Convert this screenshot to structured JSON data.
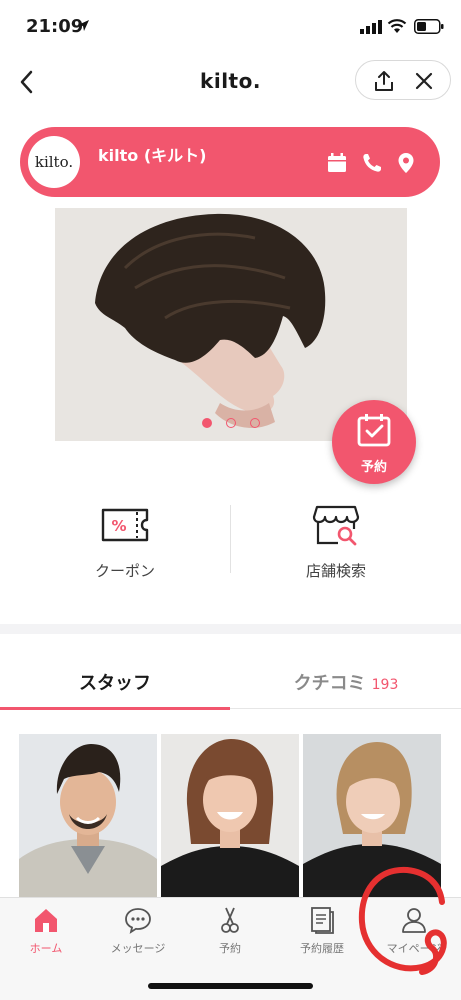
{
  "status_bar": {
    "time": "21:09"
  },
  "nav": {
    "title": "kilto."
  },
  "salon": {
    "logo_text": "kilto.",
    "name": "kilto (キルト)"
  },
  "reserve_fab": {
    "label": "予約"
  },
  "quick_actions": {
    "coupon_label": "クーポン",
    "store_search_label": "店舗検索"
  },
  "tabs": {
    "staff_label": "スタッフ",
    "reviews_label": "クチコミ",
    "reviews_count": "193"
  },
  "bottom_nav": {
    "home": "ホーム",
    "message": "メッセージ",
    "reserve": "予約",
    "history": "予約履歴",
    "mypage": "マイページ"
  },
  "colors": {
    "accent": "#f2566e",
    "annotation": "#e53030"
  }
}
